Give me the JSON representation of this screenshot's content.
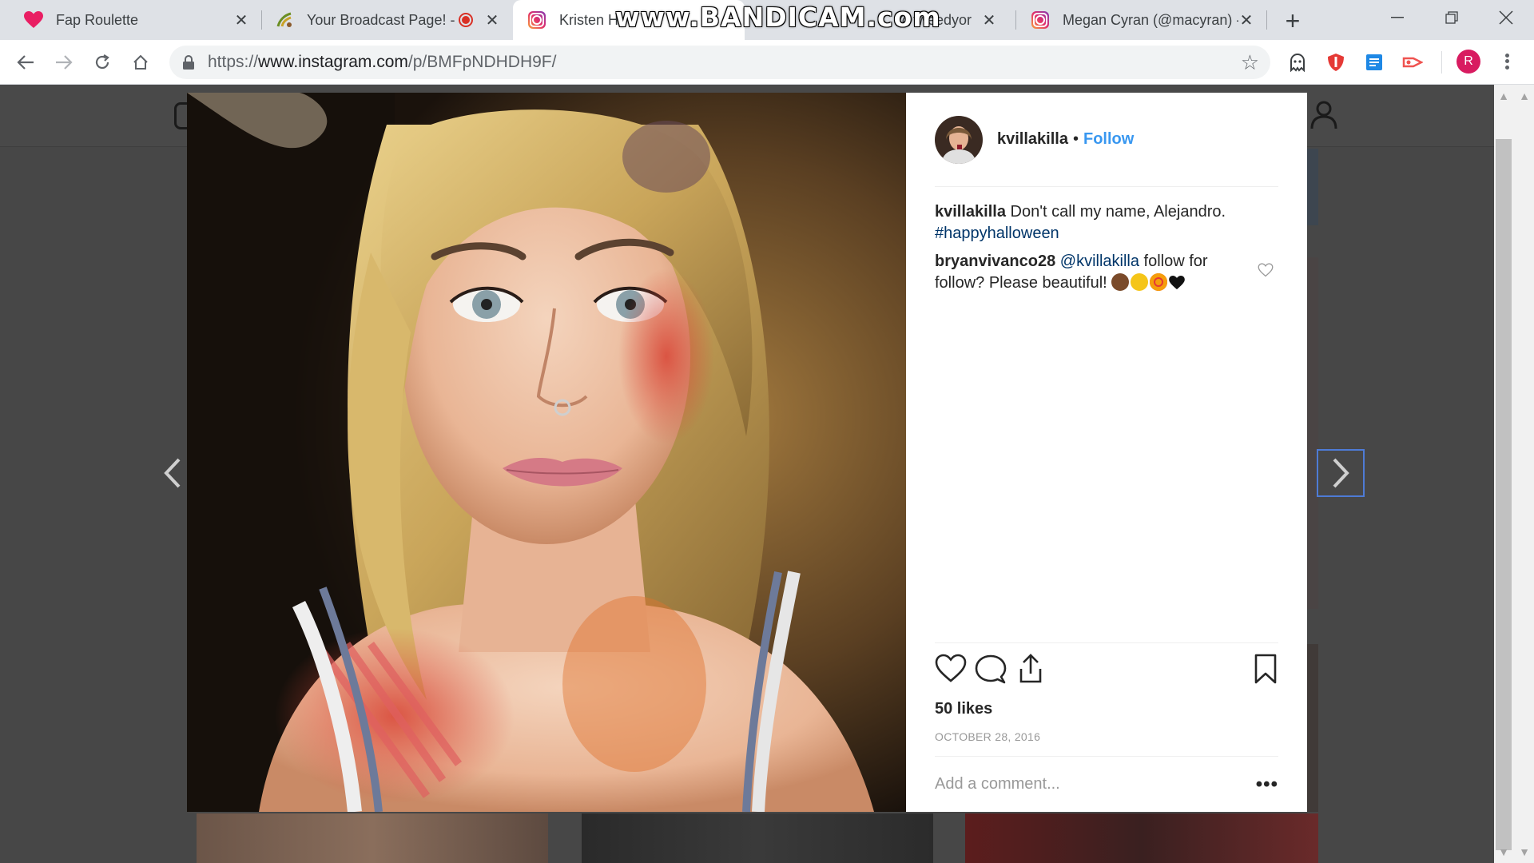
{
  "browser": {
    "tabs": [
      {
        "title": "Fap Roulette",
        "favicon": "heart-icon"
      },
      {
        "title": "Your Broadcast Page! -",
        "favicon": "broadcast-icon"
      },
      {
        "title": "Kristen Ha",
        "favicon": "instagram-icon"
      },
      {
        "title": "@tweedyor",
        "favicon": "instagram-icon"
      },
      {
        "title": "Megan Cyran (@macyran) -",
        "favicon": "instagram-icon"
      }
    ],
    "new_tab_label": "+",
    "url_prefix": "https://",
    "url_main": "www.instagram.com",
    "url_path": "/p/BMFpNDHDH9F/",
    "profile_initial": "R",
    "watermark": "www.BANDICAM.com"
  },
  "post": {
    "username": "kvillakilla",
    "separator": "•",
    "follow_label": "Follow",
    "caption": {
      "user": "kvillakilla",
      "text": " Don't call my name, Alejandro. ",
      "hashtag": "#happyhalloween"
    },
    "comment": {
      "user": "bryanvivanco28",
      "mention": "@kvillakilla",
      "text": " follow for follow? Please beautiful! "
    },
    "likes": "50 likes",
    "date": "OCTOBER 28, 2016",
    "add_comment_placeholder": "Add a comment...",
    "more_label": "•••"
  },
  "colors": {
    "follow": "#3897f0",
    "link": "#003569",
    "overlay": "#474747"
  }
}
